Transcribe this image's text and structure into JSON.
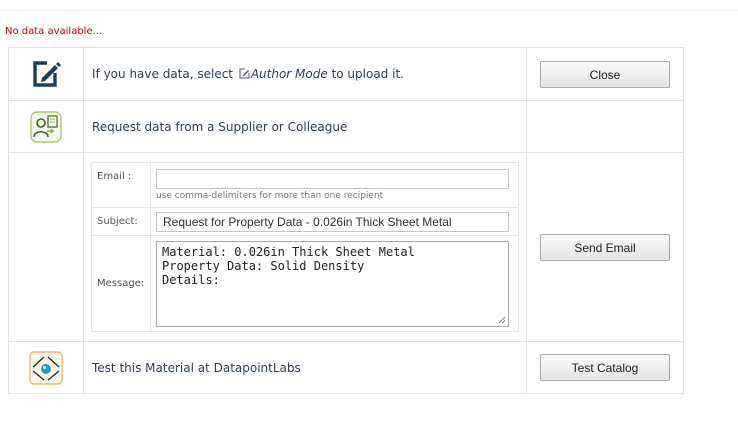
{
  "status": "No data available...",
  "author_row": {
    "text_before": "If you have data, select ",
    "mode_label": "Author Mode",
    "text_after": " to upload it.",
    "close_label": "Close"
  },
  "request_row": {
    "text": "Request data from a Supplier or Colleague"
  },
  "form": {
    "email_label": "Email :",
    "email_value": "",
    "email_hint": "use comma-delimiters for more than one recipient",
    "subject_label": "Subject:",
    "subject_value": "Request for Property Data - 0.026in Thick Sheet Metal",
    "message_label": "Message:",
    "message_lines": [
      "Material: 0.026in Thick Sheet Metal",
      "Property Data: Solid Density",
      "Details:"
    ],
    "send_label": "Send Email"
  },
  "test_row": {
    "text": "Test this Material at DatapointLabs",
    "button_label": "Test Catalog"
  },
  "icons": {
    "author": "edit-pencil-icon",
    "request": "request-data-users-icon",
    "test": "datapoint-labs-logo-icon"
  },
  "colors": {
    "status": "#d00000",
    "icon_navy": "#1f3b5c",
    "icon_green": "#7fb241",
    "logo_teal": "#1aa0b8"
  }
}
